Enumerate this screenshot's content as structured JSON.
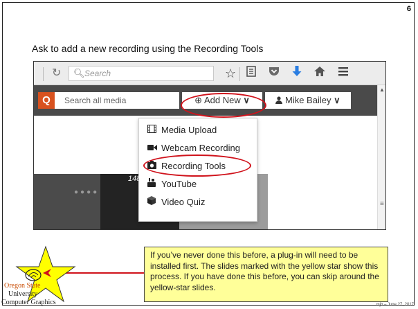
{
  "slide": {
    "number": "6",
    "heading": "Ask to add a new recording using the Recording Tools",
    "footer": "mjb – June 27, 2017"
  },
  "browser": {
    "search_placeholder": "Search",
    "icons": [
      "reload-icon",
      "search-icon",
      "star-icon",
      "reading-list-icon",
      "pocket-icon",
      "download-icon",
      "home-icon",
      "menu-icon"
    ]
  },
  "app": {
    "search_placeholder": "Search all media",
    "add_new_label": "Add New",
    "user_label": "Mike Bailey",
    "video_count": "148"
  },
  "menu": {
    "items": [
      {
        "label": "Media Upload",
        "icon": "film-icon"
      },
      {
        "label": "Webcam Recording",
        "icon": "video-camera-icon"
      },
      {
        "label": "Recording Tools",
        "icon": "camera-icon"
      },
      {
        "label": "YouTube",
        "icon": "youtube-icon"
      },
      {
        "label": "Video Quiz",
        "icon": "cube-icon"
      }
    ]
  },
  "callout": {
    "text": "If you’ve never done this before, a plug-in will need to be installed first.  The slides marked with the yellow star show this process.  If you have done this before, you can skip around the yellow-star slides."
  },
  "logo": {
    "line1": "Oregon State",
    "line2": "University",
    "line3": "Computer Graphics"
  },
  "colors": {
    "highlight_ring": "#d0121b",
    "callout_bg": "#ffff99",
    "star_fill": "#ffff00",
    "app_bar": "#4a4a4a",
    "search_accent": "#d8521f"
  }
}
